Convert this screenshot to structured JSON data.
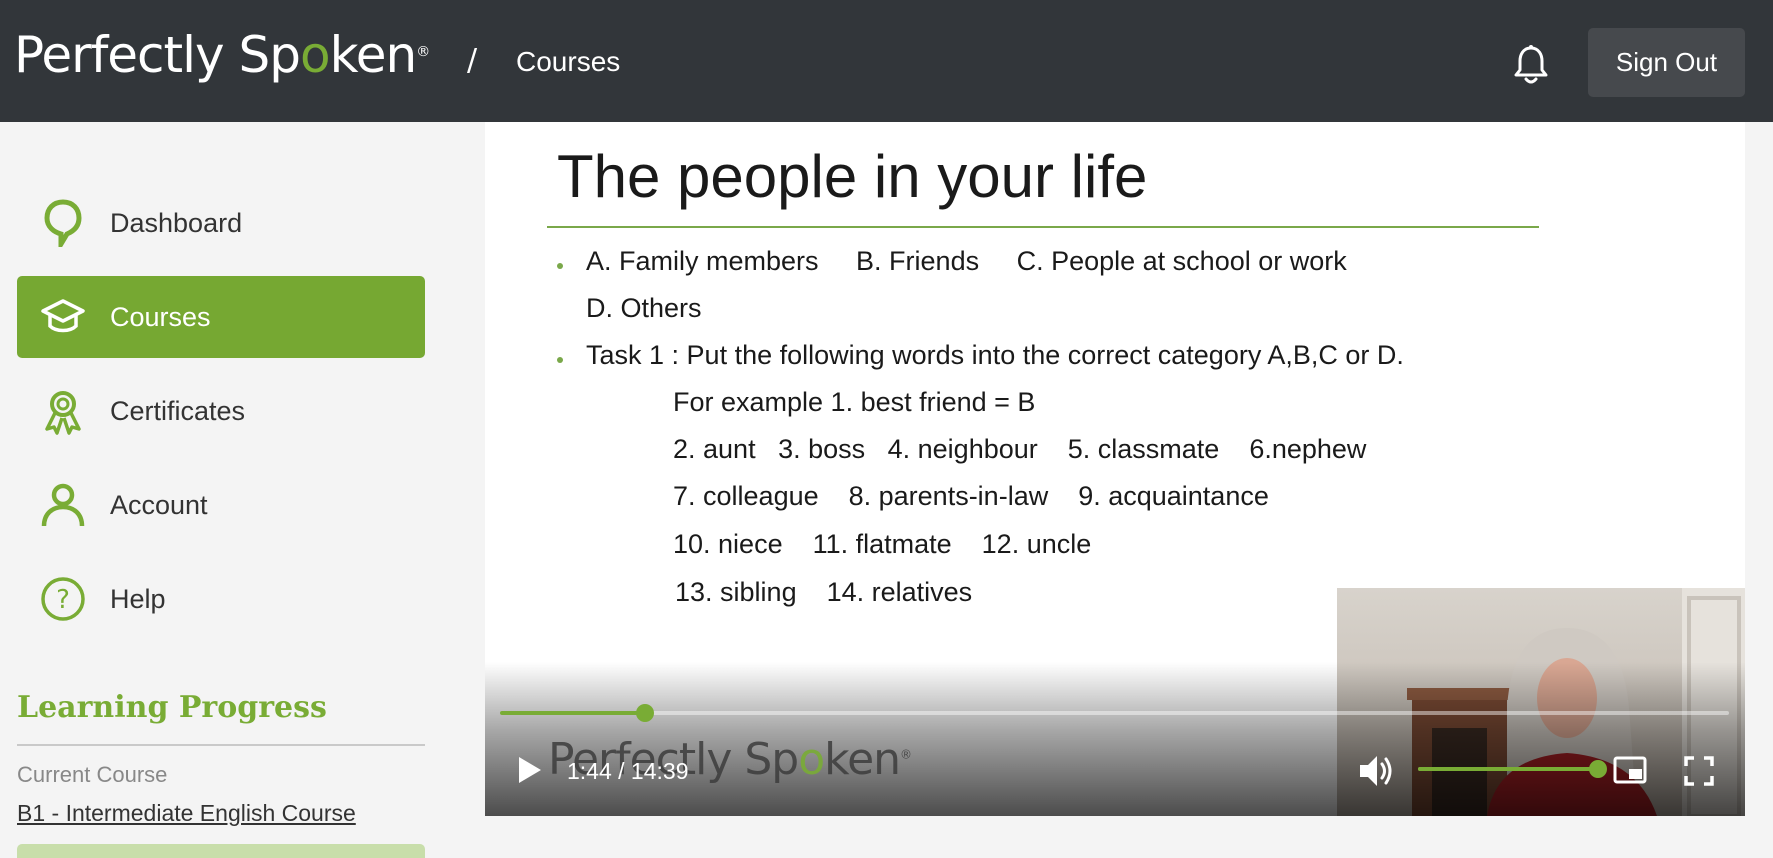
{
  "header": {
    "brand_pre": "Perfectly Sp",
    "brand_o": "o",
    "brand_post": "ken",
    "brand_reg": "®",
    "breadcrumb_sep": "/",
    "breadcrumb_current": "Courses",
    "notification_icon": "bell-icon",
    "signout_label": "Sign Out",
    "bg_color": "#32363a"
  },
  "sidebar": {
    "items": [
      {
        "label": "Dashboard",
        "icon": "location-pin-icon",
        "active": false
      },
      {
        "label": "Courses",
        "icon": "graduation-cap-icon",
        "active": true
      },
      {
        "label": "Certificates",
        "icon": "award-ribbon-icon",
        "active": false
      },
      {
        "label": "Account",
        "icon": "user-icon",
        "active": false
      },
      {
        "label": "Help",
        "icon": "question-circle-icon",
        "active": false
      }
    ],
    "accent_color": "#76a832",
    "learning_progress": {
      "title": "Learning Progress",
      "current_course_label": "Current Course",
      "current_course_name": "B1 - Intermediate English Course"
    }
  },
  "video": {
    "slide": {
      "title": "The people in your life",
      "line1": "A. Family members     B. Friends     C. People at school or work",
      "line2": "D. Others",
      "line3": "Task 1 : Put the following words into the correct category A,B,C or D.",
      "line4": "For example 1. best friend = B",
      "line5": "2. aunt   3. boss   4. neighbour    5. classmate    6.nephew",
      "line6": "7. colleague    8. parents-in-law    9. acquaintance",
      "line7": "10. niece    11. flatmate    12. uncle",
      "line8": "13. sibling    14. relatives"
    },
    "watermark_pre": "Perfectly Sp",
    "watermark_o": "o",
    "watermark_post": "ken",
    "watermark_reg": "®",
    "time_display": "1:44 / 14:39",
    "progress_fraction": 0.118,
    "volume_fraction": 1.0,
    "controls": {
      "play_icon": "play-icon",
      "volume_icon": "volume-icon",
      "pip_icon": "picture-in-picture-icon",
      "fullscreen_icon": "fullscreen-icon"
    }
  }
}
